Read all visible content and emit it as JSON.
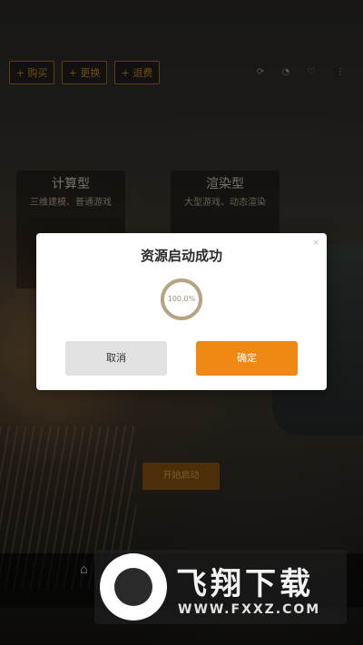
{
  "toolbar": {
    "buttons": [
      {
        "label": "+ 购买"
      },
      {
        "label": "+ 更换"
      },
      {
        "label": "+ 退费"
      }
    ],
    "icons": [
      "refresh-icon",
      "user-icon",
      "heart-icon",
      "menu-icon"
    ]
  },
  "modes": [
    {
      "title": "计算型",
      "desc": "三维建模、普通游戏"
    },
    {
      "title": "渲染型",
      "desc": "大型游戏、动态渲染"
    }
  ],
  "start_button": {
    "label": "开始启动"
  },
  "modal": {
    "title": "资源启动成功",
    "progress_text": "100.0%",
    "progress": 1.0,
    "cancel_label": "取消",
    "confirm_label": "确定",
    "close_icon": "close-icon",
    "accent_color": "#ee8a13"
  },
  "watermark": {
    "name": "飞翔下载",
    "url": "WWW.FXXZ.COM"
  }
}
